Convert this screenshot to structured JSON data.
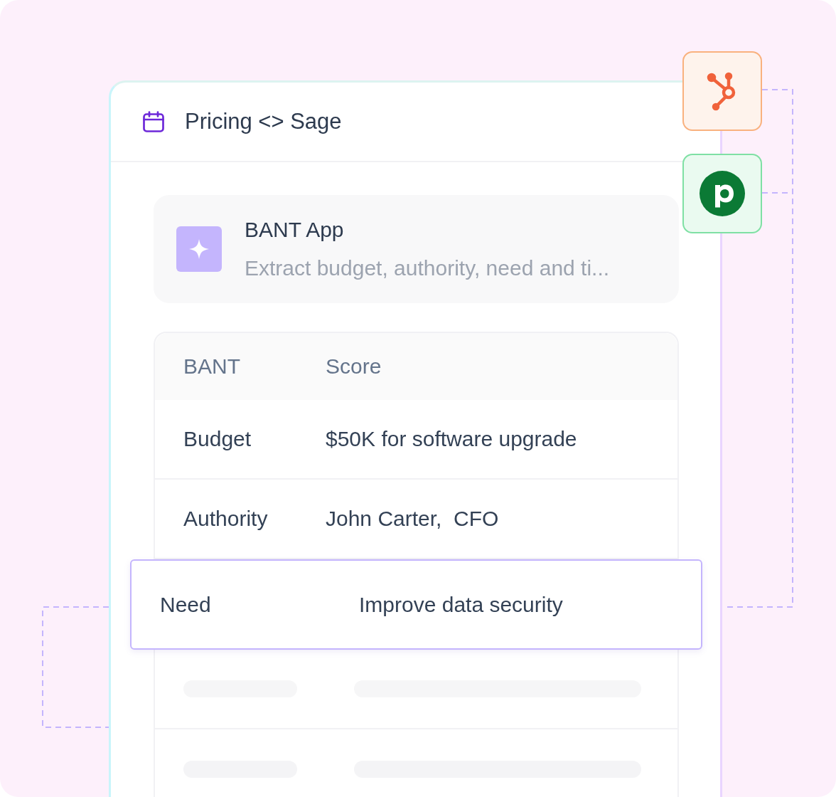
{
  "card": {
    "title": "Pricing <> Sage"
  },
  "app": {
    "name": "BANT App",
    "description": "Extract budget, authority, need and ti..."
  },
  "table": {
    "columns": [
      "BANT",
      "Score"
    ],
    "rows": [
      {
        "kind": "text",
        "cells": [
          "Budget",
          "$50K for software upgrade"
        ]
      },
      {
        "kind": "text",
        "cells": [
          "Authority",
          "John Carter,  CFO"
        ]
      },
      {
        "kind": "highlighted",
        "cells": [
          "Need",
          "Improve data security"
        ]
      },
      {
        "kind": "skeleton"
      },
      {
        "kind": "faded"
      }
    ]
  },
  "integrations": [
    {
      "kind": "hub"
    },
    {
      "kind": "p"
    }
  ]
}
